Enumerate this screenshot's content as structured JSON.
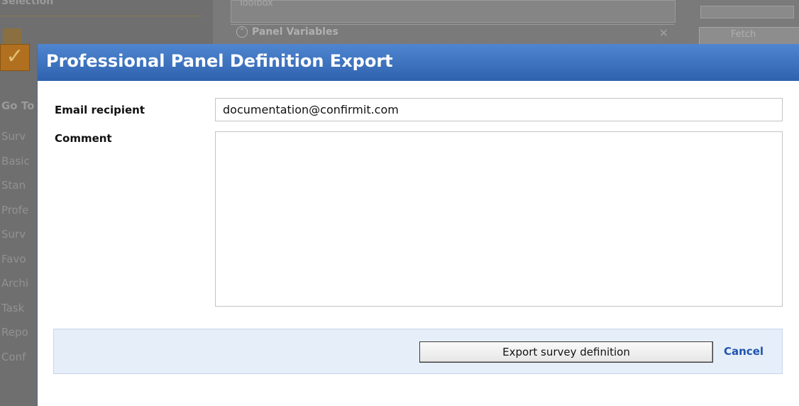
{
  "background": {
    "toolbox_label": "Toolbox",
    "panel_variables_label": "Panel Variables",
    "sidebar_heading": "Go To",
    "sidebar_items": [
      "Surv",
      "Basic",
      "Stan",
      "Profe",
      "Surv",
      "Favo",
      "Archi",
      "Task",
      "Repo",
      "Conf"
    ],
    "right_button_label": "Fetch"
  },
  "dialog": {
    "title": "Professional Panel Definition Export",
    "email_label": "Email recipient",
    "email_value": "documentation@confirmit.com",
    "comment_label": "Comment",
    "comment_value": "",
    "export_button": "Export survey definition",
    "cancel_link": "Cancel"
  },
  "colors": {
    "titlebar": "#2f62ae",
    "footer_bg": "#e6eef9",
    "link": "#1f55b0"
  }
}
